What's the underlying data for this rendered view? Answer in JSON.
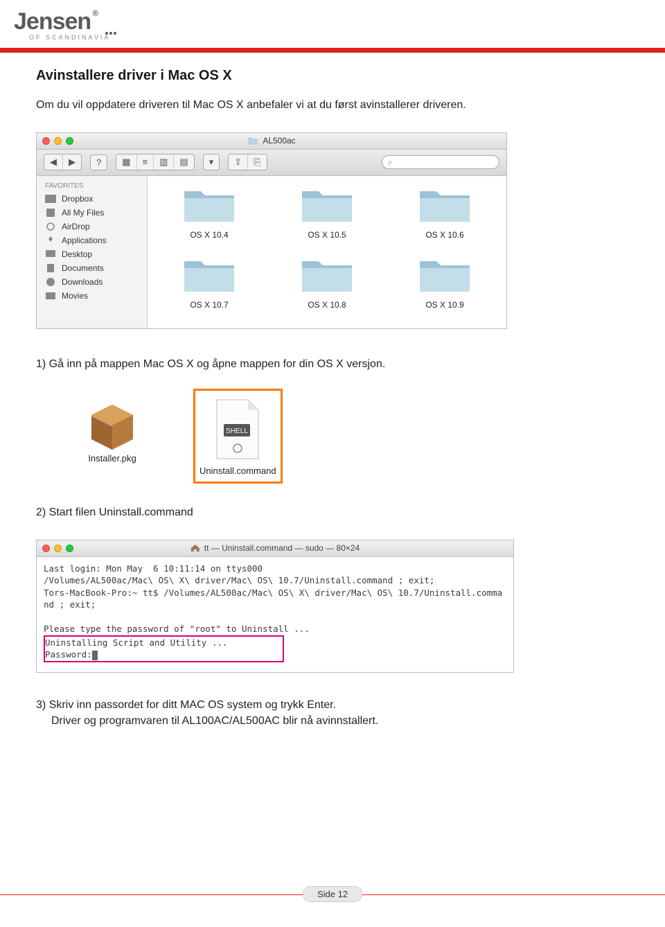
{
  "brand": {
    "name": "Jensen",
    "tagline": "OF SCANDINAVIA"
  },
  "page": {
    "title": "Avinstallere driver i Mac OS X",
    "intro": "Om du vil oppdatere driveren til Mac OS X anbefaler vi at du først avinstallerer driveren.",
    "step1": "1) Gå inn på mappen Mac OS X og åpne mappen for din OS X versjon.",
    "step2": "2) Start filen Uninstall.command",
    "step3a": "3) Skriv inn passordet for ditt MAC OS system og trykk Enter.",
    "step3b": "Driver og programvaren til AL100AC/AL500AC blir nå avinnstallert.",
    "footer": "Side 12"
  },
  "finder": {
    "title": "AL500ac",
    "sidebar_header": "FAVORITES",
    "sidebar": [
      {
        "label": "Dropbox"
      },
      {
        "label": "All My Files"
      },
      {
        "label": "AirDrop"
      },
      {
        "label": "Applications"
      },
      {
        "label": "Desktop"
      },
      {
        "label": "Documents"
      },
      {
        "label": "Downloads"
      },
      {
        "label": "Movies"
      }
    ],
    "folders": [
      "OS X 10.4",
      "OS X 10.5",
      "OS X 10.6",
      "OS X 10.7",
      "OS X 10.8",
      "OS X 10.9"
    ]
  },
  "icons": {
    "pkg": "Installer.pkg",
    "shell": "Uninstall.command",
    "shell_badge": "SHELL"
  },
  "terminal": {
    "title": "tt — Uninstall.command — sudo — 80×24",
    "line1": "Last login: Mon May  6 10:11:14 on ttys000",
    "line2": "/Volumes/AL500ac/Mac\\ OS\\ X\\ driver/Mac\\ OS\\ 10.7/Uninstall.command ; exit;",
    "line3": "Tors-MacBook-Pro:~ tt$ /Volumes/AL500ac/Mac\\ OS\\ X\\ driver/Mac\\ OS\\ 10.7/Uninstall.command ; exit;",
    "line5": "Please type the password of \"root\" to Uninstall ...",
    "line6": "Uninstalling Script and Utility ...",
    "line7": "Password:"
  }
}
